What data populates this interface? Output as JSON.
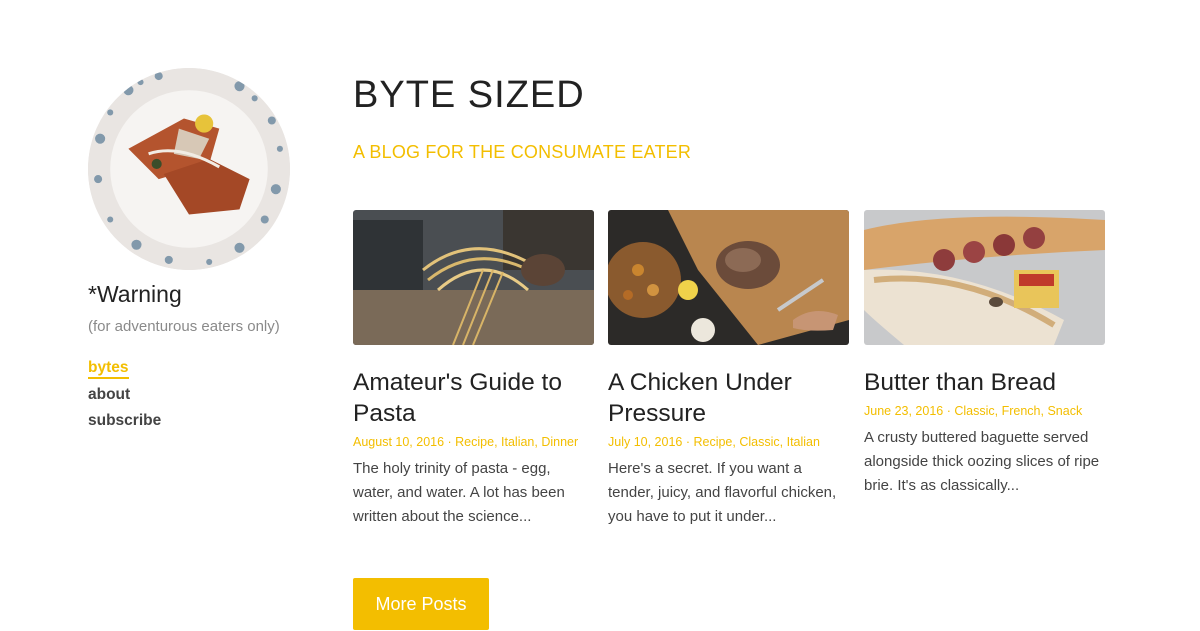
{
  "sidebar": {
    "title": "*Warning",
    "subtitle": "(for adventurous eaters only)",
    "nav": [
      {
        "label": "bytes",
        "active": true
      },
      {
        "label": "about",
        "active": false
      },
      {
        "label": "subscribe",
        "active": false
      }
    ]
  },
  "header": {
    "title": "BYTE SIZED",
    "tagline": "A BLOG FOR THE CONSUMATE EATER"
  },
  "posts": [
    {
      "title": "Amateur's Guide to Pasta",
      "date": "August 10, 2016",
      "tags": [
        "Recipe",
        "Italian",
        "Dinner"
      ],
      "excerpt": "The holy trinity of pasta - egg, water, and water. A lot has been written about the science..."
    },
    {
      "title": "A Chicken Under Pressure",
      "date": "July 10, 2016",
      "tags": [
        "Recipe",
        "Classic",
        "Italian"
      ],
      "excerpt": "Here's a secret. If you want a tender, juicy, and flavorful chicken, you have to put it under..."
    },
    {
      "title": "Butter than Bread",
      "date": "June 23, 2016",
      "tags": [
        "Classic",
        "French",
        "Snack"
      ],
      "excerpt": "A crusty buttered baguette served alongside thick oozing slices of ripe brie. It's as classically..."
    }
  ],
  "more_button": "More Posts",
  "colors": {
    "accent": "#f3be00",
    "text": "#222222",
    "muted": "#8a8a8a"
  }
}
